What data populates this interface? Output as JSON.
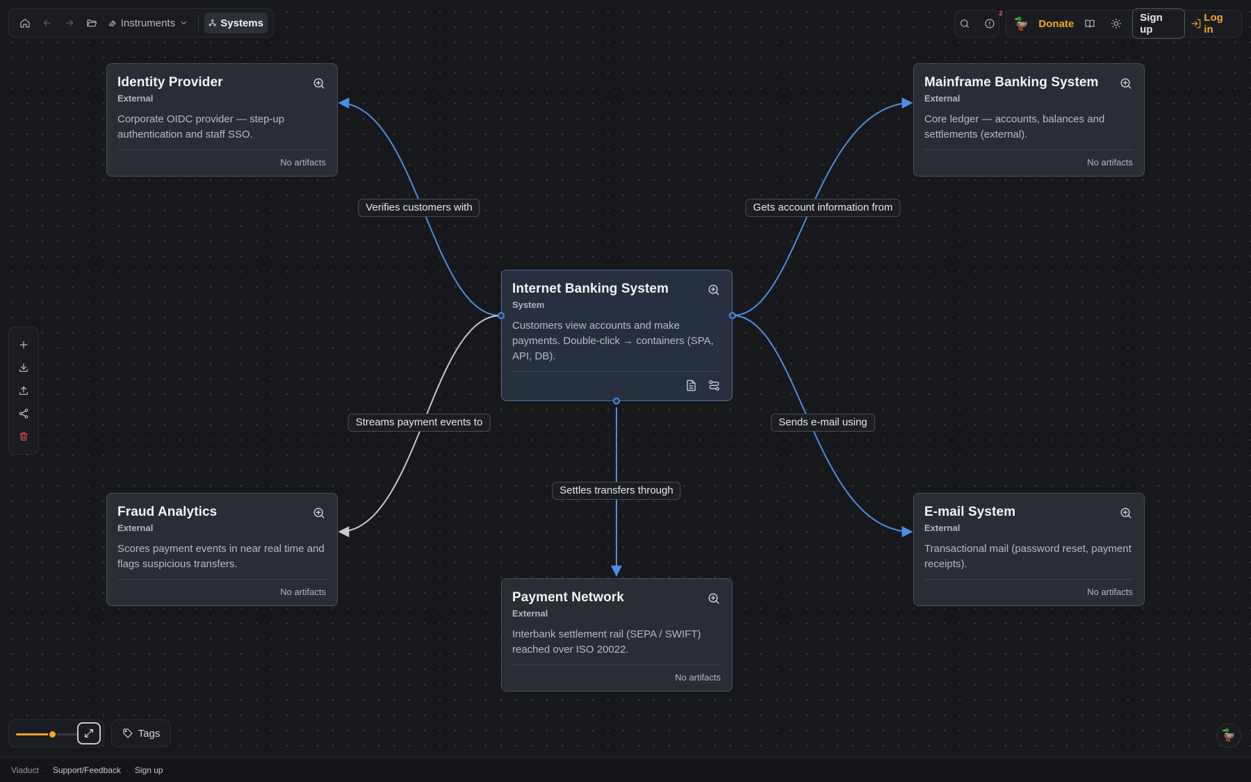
{
  "toolbar": {
    "instruments_label": "Instruments",
    "systems_label": "Systems"
  },
  "top_right": {
    "notification_count": "2",
    "donate_label": "Donate",
    "signup_label": "Sign up",
    "login_label": "Log in"
  },
  "nodes": {
    "identity": {
      "title": "Identity Provider",
      "kind": "External",
      "desc": "Corporate OIDC provider — step-up authentication and staff SSO.",
      "footer": "No artifacts"
    },
    "mainframe": {
      "title": "Mainframe Banking System",
      "kind": "External",
      "desc": "Core ledger — accounts, balances and settlements (external).",
      "footer": "No artifacts"
    },
    "banking": {
      "title": "Internet Banking System",
      "kind": "System",
      "desc": "Customers view accounts and make payments. Double-click → containers (SPA, API, DB)."
    },
    "fraud": {
      "title": "Fraud Analytics",
      "kind": "External",
      "desc": "Scores payment events in near real time and flags suspicious transfers.",
      "footer": "No artifacts"
    },
    "payment": {
      "title": "Payment Network",
      "kind": "External",
      "desc": "Interbank settlement rail (SEPA / SWIFT) reached over ISO 20022.",
      "footer": "No artifacts"
    },
    "email": {
      "title": "E-mail System",
      "kind": "External",
      "desc": "Transactional mail (password reset, payment receipts).",
      "footer": "No artifacts"
    }
  },
  "edges": {
    "verifies": "Verifies customers with",
    "gets_account": "Gets account information from",
    "streams": "Streams payment events to",
    "sends_email": "Sends e-mail using",
    "settles": "Settles transfers through"
  },
  "colors": {
    "accent": "#f5a623",
    "edge_blue": "#4a90e2",
    "edge_gray": "#c8cad0",
    "danger": "#e0524f"
  },
  "zoom": {
    "level": 0.58
  },
  "tags_label": "Tags",
  "footer": {
    "brand": "Viaduct",
    "support": "Support/Feedback",
    "signup": "Sign up"
  }
}
